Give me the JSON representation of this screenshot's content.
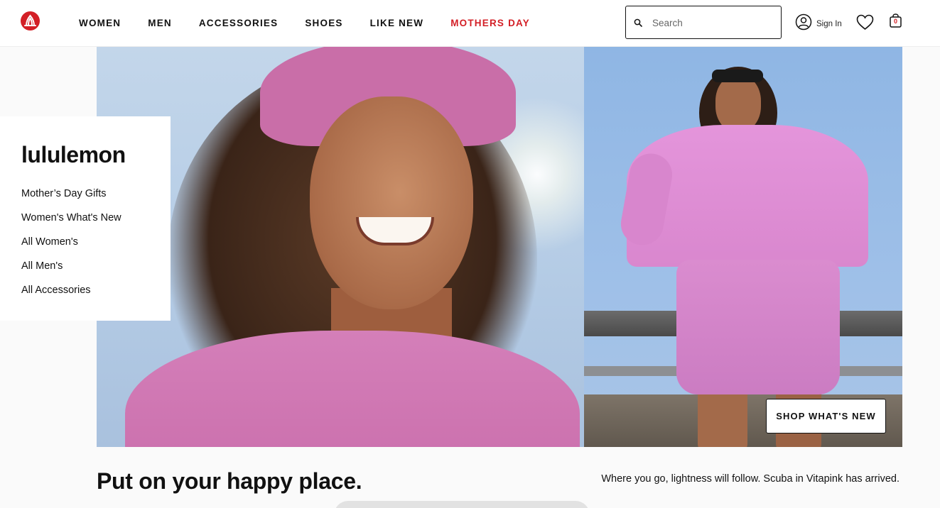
{
  "header": {
    "logo": "lululemon-logo-icon",
    "nav": [
      {
        "label": "WOMEN"
      },
      {
        "label": "MEN"
      },
      {
        "label": "ACCESSORIES"
      },
      {
        "label": "SHOES"
      },
      {
        "label": "LIKE NEW"
      },
      {
        "label": "MOTHERS DAY",
        "color": "#d31f26"
      }
    ],
    "search": {
      "placeholder": "Search",
      "icon": "search-icon"
    },
    "sign_in": {
      "label": "Sign In",
      "icon": "user-icon"
    },
    "wishlist": {
      "icon": "heart-icon"
    },
    "bag": {
      "icon": "shopping-bag-icon",
      "count": "0"
    }
  },
  "sidebar": {
    "brand": "lululemon",
    "links": [
      {
        "label": "Mother’s Day Gifts"
      },
      {
        "label": "Women's What's New"
      },
      {
        "label": "All Women's"
      },
      {
        "label": "All Men's"
      },
      {
        "label": "All Accessories"
      }
    ]
  },
  "hero": {
    "cta_label": "SHOP WHAT'S NEW",
    "headline": "Put on your happy place.",
    "tagline": "Where you go, lightness will follow. Scuba in Vitapink has arrived."
  },
  "colors": {
    "brand_red": "#d31f26",
    "pink": "#d47fb9"
  }
}
